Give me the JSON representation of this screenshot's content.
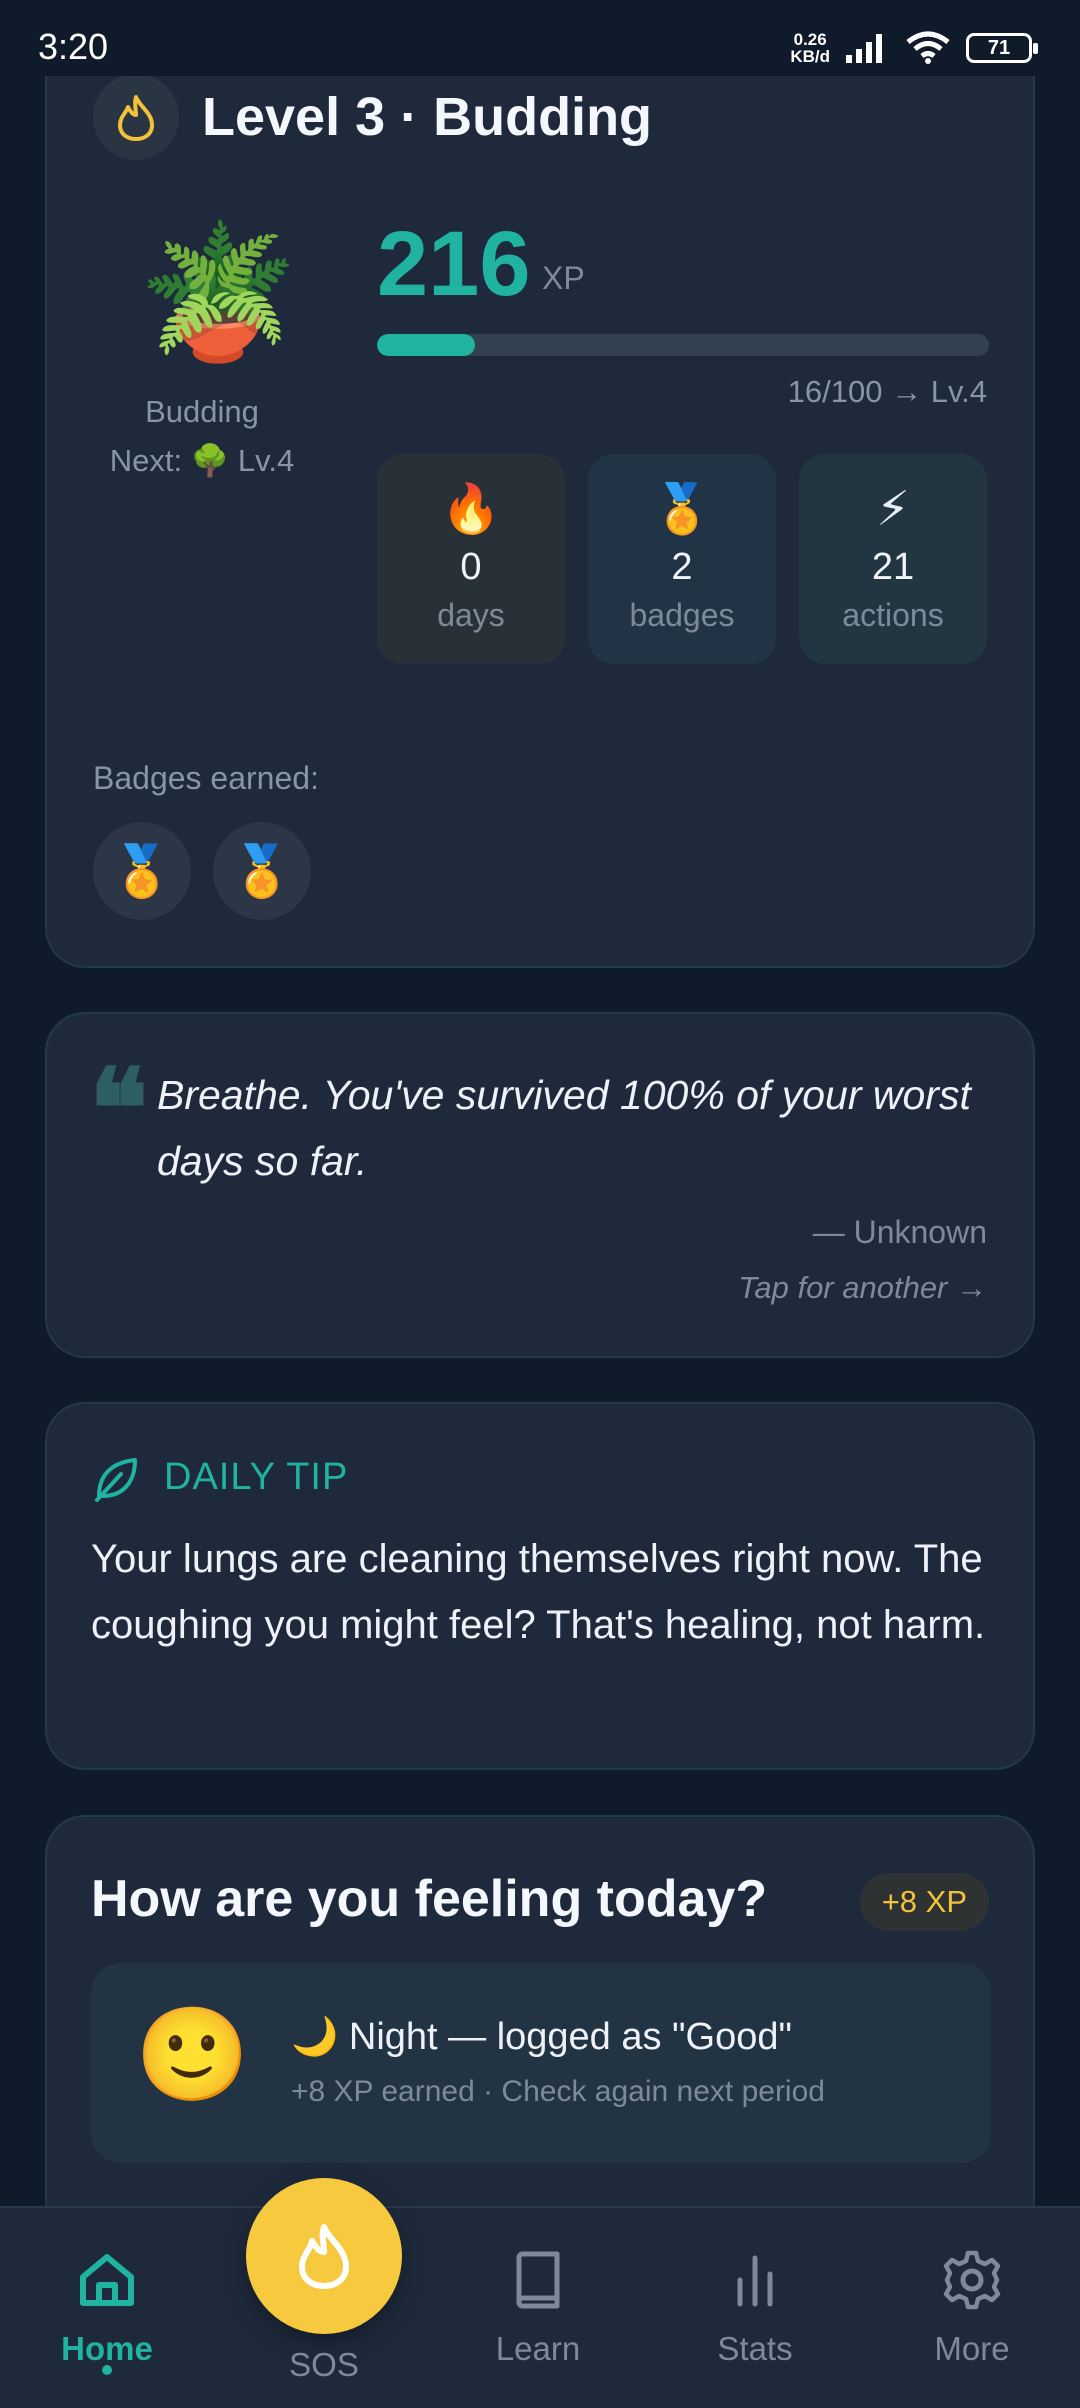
{
  "status_bar": {
    "time": "3:20",
    "speed": "0.26",
    "speed_unit": "KB/d",
    "battery": "71"
  },
  "level_card": {
    "title": "Level 3 · Budding",
    "plant_emoji": "🪴",
    "plant_label": "Budding",
    "next_label": "Next: 🌳 Lv.4",
    "xp_value": "216",
    "xp_unit": "XP",
    "xp_progress_text": "16/100 → Lv.4",
    "xp_progress_fraction": 0.16,
    "stats": [
      {
        "emoji": "🔥",
        "value": "0",
        "label": "days"
      },
      {
        "emoji": "🏅",
        "value": "2",
        "label": "badges"
      },
      {
        "emoji": "⚡",
        "value": "21",
        "label": "actions"
      }
    ],
    "badges_label": "Badges earned:",
    "badges": [
      "🏅",
      "🏅"
    ]
  },
  "quote_card": {
    "mark": "❝",
    "text": "Breathe. You've survived 100% of your worst days so far.",
    "author": "— Unknown",
    "tap_label": "Tap for another →"
  },
  "tip_card": {
    "heading": "DAILY TIP",
    "text": "Your lungs are cleaning themselves right now. The coughing you might feel? That's healing, not harm."
  },
  "mood_card": {
    "title": "How are you feeling today?",
    "xp_pill": "+8 XP",
    "face": "🙂",
    "line": "🌙 Night — logged as \"Good\"",
    "sub": "+8 XP earned · Check again next period"
  },
  "nav": {
    "home": "Home",
    "sos": "SOS",
    "learn": "Learn",
    "stats": "Stats",
    "more": "More"
  },
  "colors": {
    "accent": "#1fb3a0",
    "sos": "#f7c93e",
    "background": "#0f1a2a",
    "card": "#1e2a3c"
  }
}
